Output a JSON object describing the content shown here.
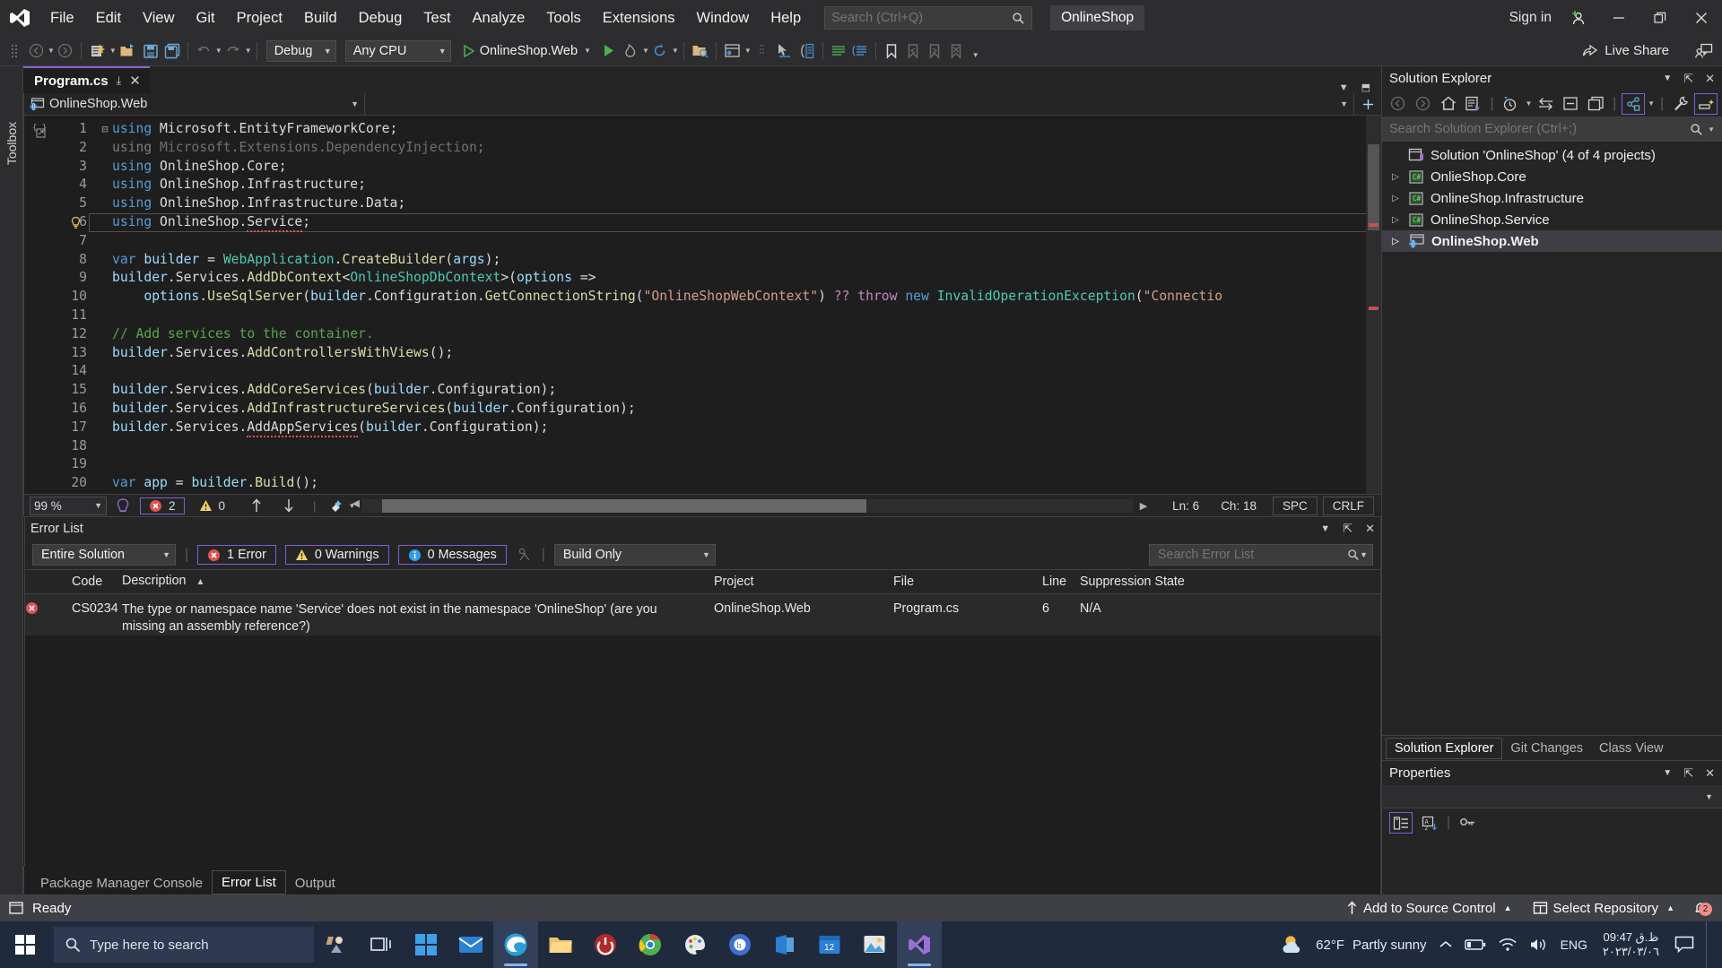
{
  "titlebar": {
    "menus": [
      "File",
      "Edit",
      "View",
      "Git",
      "Project",
      "Build",
      "Debug",
      "Test",
      "Analyze",
      "Tools",
      "Extensions",
      "Window",
      "Help"
    ],
    "search_placeholder": "Search (Ctrl+Q)",
    "solution_chip": "OnlineShop",
    "signin": "Sign in",
    "minimize": "—",
    "restore": "❐",
    "close": "✕"
  },
  "toolbar": {
    "config": "Debug",
    "platform": "Any CPU",
    "run_target": "OnlineShop.Web",
    "live_share": "Live Share"
  },
  "toolbox": {
    "label": "Toolbox"
  },
  "editor": {
    "tab_title": "Program.cs",
    "tab_close": "✕",
    "tab_pin": "⤓",
    "nav_project": "OnlineShop.Web",
    "nav_type": "",
    "nav_member": "",
    "status": {
      "zoom": "99 %",
      "errors": "2",
      "warnings": "0",
      "line": "Ln: 6",
      "char": "Ch: 18",
      "spaces": "SPC",
      "eol": "CRLF"
    },
    "lines": [
      {
        "n": "1",
        "fold": "⊟",
        "tokens": [
          [
            "kw",
            "using"
          ],
          [
            "id",
            " Microsoft"
          ],
          [
            "punc",
            "."
          ],
          [
            "id",
            "EntityFrameworkCore"
          ],
          [
            "punc",
            ";"
          ]
        ]
      },
      {
        "n": "2",
        "fold": "",
        "tokens": [
          [
            "dim",
            "using"
          ],
          [
            "dimid",
            " Microsoft"
          ],
          [
            "dim",
            "."
          ],
          [
            "dimid",
            "Extensions"
          ],
          [
            "dim",
            "."
          ],
          [
            "dimid",
            "DependencyInjection"
          ],
          [
            "dim",
            ";"
          ]
        ]
      },
      {
        "n": "3",
        "fold": "",
        "tokens": [
          [
            "kw",
            "using"
          ],
          [
            "id",
            " OnlineShop"
          ],
          [
            "punc",
            "."
          ],
          [
            "id",
            "Core"
          ],
          [
            "punc",
            ";"
          ]
        ]
      },
      {
        "n": "4",
        "fold": "",
        "tokens": [
          [
            "kw",
            "using"
          ],
          [
            "id",
            " OnlineShop"
          ],
          [
            "punc",
            "."
          ],
          [
            "id",
            "Infrastructure"
          ],
          [
            "punc",
            ";"
          ]
        ]
      },
      {
        "n": "5",
        "fold": "",
        "tokens": [
          [
            "kw",
            "using"
          ],
          [
            "id",
            " OnlineShop"
          ],
          [
            "punc",
            "."
          ],
          [
            "id",
            "Infrastructure"
          ],
          [
            "punc",
            "."
          ],
          [
            "id",
            "Data"
          ],
          [
            "punc",
            ";"
          ]
        ]
      },
      {
        "n": "6",
        "fold": "",
        "bulb": true,
        "current": true,
        "tokens": [
          [
            "kw",
            "using"
          ],
          [
            "id",
            " OnlineShop"
          ],
          [
            "punc",
            "."
          ],
          [
            "err",
            "Service"
          ],
          [
            "punc",
            ";"
          ]
        ]
      },
      {
        "n": "7",
        "fold": "",
        "tokens": []
      },
      {
        "n": "8",
        "fold": "",
        "tokens": [
          [
            "kw",
            "var"
          ],
          [
            "par",
            " builder"
          ],
          [
            "punc",
            " = "
          ],
          [
            "type",
            "WebApplication"
          ],
          [
            "punc",
            "."
          ],
          [
            "mth",
            "CreateBuilder"
          ],
          [
            "punc",
            "("
          ],
          [
            "par",
            "args"
          ],
          [
            "punc",
            ");"
          ]
        ]
      },
      {
        "n": "9",
        "fold": "",
        "tokens": [
          [
            "par",
            "builder"
          ],
          [
            "punc",
            "."
          ],
          [
            "id",
            "Services"
          ],
          [
            "punc",
            "."
          ],
          [
            "mth",
            "AddDbContext"
          ],
          [
            "punc",
            "<"
          ],
          [
            "type",
            "OnlineShopDbContext"
          ],
          [
            "punc",
            ">("
          ],
          [
            "par",
            "options"
          ],
          [
            "punc",
            " =>"
          ]
        ]
      },
      {
        "n": "10",
        "fold": "",
        "tokens": [
          [
            "punc",
            "    "
          ],
          [
            "par",
            "options"
          ],
          [
            "punc",
            "."
          ],
          [
            "mth",
            "UseSqlServer"
          ],
          [
            "punc",
            "("
          ],
          [
            "par",
            "builder"
          ],
          [
            "punc",
            "."
          ],
          [
            "id",
            "Configuration"
          ],
          [
            "punc",
            "."
          ],
          [
            "mth",
            "GetConnectionString"
          ],
          [
            "punc",
            "("
          ],
          [
            "str",
            "\"OnlineShopWebContext\""
          ],
          [
            "punc",
            ") "
          ],
          [
            "kw2",
            "??"
          ],
          [
            "punc",
            " "
          ],
          [
            "kw2",
            "throw"
          ],
          [
            "punc",
            " "
          ],
          [
            "kw",
            "new"
          ],
          [
            "punc",
            " "
          ],
          [
            "type",
            "InvalidOperationException"
          ],
          [
            "punc",
            "("
          ],
          [
            "str",
            "\"Connectio"
          ]
        ]
      },
      {
        "n": "11",
        "fold": "",
        "tokens": []
      },
      {
        "n": "12",
        "fold": "",
        "tokens": [
          [
            "com",
            "// Add services to the container."
          ]
        ]
      },
      {
        "n": "13",
        "fold": "",
        "tokens": [
          [
            "par",
            "builder"
          ],
          [
            "punc",
            "."
          ],
          [
            "id",
            "Services"
          ],
          [
            "punc",
            "."
          ],
          [
            "mth",
            "AddControllersWithViews"
          ],
          [
            "punc",
            "();"
          ]
        ]
      },
      {
        "n": "14",
        "fold": "",
        "tokens": []
      },
      {
        "n": "15",
        "fold": "",
        "tokens": [
          [
            "par",
            "builder"
          ],
          [
            "punc",
            "."
          ],
          [
            "id",
            "Services"
          ],
          [
            "punc",
            "."
          ],
          [
            "mth",
            "AddCoreServices"
          ],
          [
            "punc",
            "("
          ],
          [
            "par",
            "builder"
          ],
          [
            "punc",
            "."
          ],
          [
            "id",
            "Configuration"
          ],
          [
            "punc",
            ");"
          ]
        ]
      },
      {
        "n": "16",
        "fold": "",
        "tokens": [
          [
            "par",
            "builder"
          ],
          [
            "punc",
            "."
          ],
          [
            "id",
            "Services"
          ],
          [
            "punc",
            "."
          ],
          [
            "mth",
            "AddInfrastructureServices"
          ],
          [
            "punc",
            "("
          ],
          [
            "par",
            "builder"
          ],
          [
            "punc",
            "."
          ],
          [
            "id",
            "Configuration"
          ],
          [
            "punc",
            ");"
          ]
        ]
      },
      {
        "n": "17",
        "fold": "",
        "tokens": [
          [
            "par",
            "builder"
          ],
          [
            "punc",
            "."
          ],
          [
            "id",
            "Services"
          ],
          [
            "punc",
            "."
          ],
          [
            "err",
            "AddAppServices"
          ],
          [
            "punc",
            "("
          ],
          [
            "par",
            "builder"
          ],
          [
            "punc",
            "."
          ],
          [
            "id",
            "Configuration"
          ],
          [
            "punc",
            ");"
          ]
        ]
      },
      {
        "n": "18",
        "fold": "",
        "tokens": []
      },
      {
        "n": "19",
        "fold": "",
        "tokens": []
      },
      {
        "n": "20",
        "fold": "",
        "tokens": [
          [
            "kw",
            "var"
          ],
          [
            "par",
            " app"
          ],
          [
            "punc",
            " = "
          ],
          [
            "par",
            "builder"
          ],
          [
            "punc",
            "."
          ],
          [
            "mth",
            "Build"
          ],
          [
            "punc",
            "();"
          ]
        ]
      }
    ]
  },
  "error_list": {
    "title": "Error List",
    "scope": "Entire Solution",
    "errors_label": "1 Error",
    "warnings_label": "0 Warnings",
    "messages_label": "0 Messages",
    "build_filter": "Build Only",
    "search_placeholder": "Search Error List",
    "columns": [
      "Code",
      "Description",
      "Project",
      "File",
      "Line",
      "Suppression State"
    ],
    "sort_indicator": "▲",
    "rows": [
      {
        "code": "CS0234",
        "description": "The type or namespace name 'Service' does not exist in the namespace 'OnlineShop' (are you missing an assembly reference?)",
        "project": "OnlineShop.Web",
        "file": "Program.cs",
        "line": "6",
        "suppression": "N/A"
      }
    ],
    "bottom_tabs": [
      "Package Manager Console",
      "Error List",
      "Output"
    ],
    "bottom_active": "Error List"
  },
  "solution_explorer": {
    "title": "Solution Explorer",
    "search_placeholder": "Search Solution Explorer (Ctrl+;)",
    "root": "Solution 'OnlineShop' (4 of 4 projects)",
    "projects": [
      {
        "name": "OnlieShop.Core",
        "icon": "csharp-project-icon",
        "selected": false
      },
      {
        "name": "OnlineShop.Infrastructure",
        "icon": "csharp-project-icon",
        "selected": false
      },
      {
        "name": "OnlineShop.Service",
        "icon": "csharp-project-icon",
        "selected": false
      },
      {
        "name": "OnlineShop.Web",
        "icon": "web-project-icon",
        "selected": true
      }
    ],
    "dock_tabs": [
      "Solution Explorer",
      "Git Changes",
      "Class View"
    ],
    "dock_active": "Solution Explorer"
  },
  "properties": {
    "title": "Properties"
  },
  "status_bar": {
    "ready": "Ready",
    "add_source_control": "Add to Source Control",
    "select_repository": "Select Repository",
    "notifications": "2"
  },
  "taskbar": {
    "search_placeholder": "Type here to search",
    "weather_temp": "62°F",
    "weather_desc": "Partly sunny",
    "language": "ENG",
    "time": "09:47 ظ.ق",
    "date": "٢٠٢٣/٠٣/٠٦"
  },
  "colors": {
    "accent_purple": "#8a62d4",
    "error_red": "#e05252",
    "warning_yellow": "#f0d36a",
    "info_blue": "#2e9fe8",
    "run_green": "#4caf50",
    "status_bar": "#3f3f46",
    "taskbar": "#1f2a3d"
  }
}
